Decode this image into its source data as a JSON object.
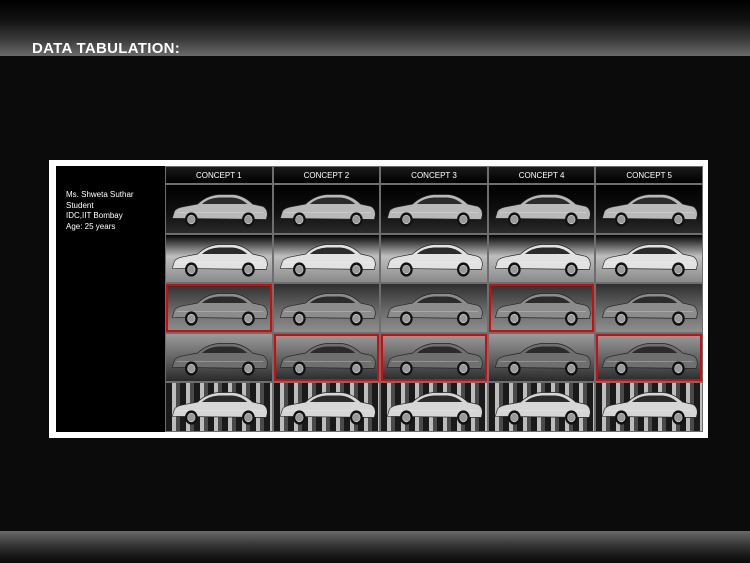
{
  "slide": {
    "title": "DATA TABULATION:"
  },
  "respondent": {
    "name": "Ms. Shweta Suthar",
    "role": "Student",
    "institute": "IDC,IIT Bombay",
    "age": "Age: 25 years"
  },
  "table": {
    "columns": [
      "CONCEPT 1",
      "CONCEPT 2",
      "CONCEPT 3",
      "CONCEPT 4",
      "CONCEPT 5"
    ],
    "rows": [
      {
        "selected": [
          false,
          false,
          false,
          false,
          false
        ],
        "car_color": "#b9b9b9"
      },
      {
        "selected": [
          false,
          false,
          false,
          false,
          false
        ],
        "car_color": "#e2e2e2"
      },
      {
        "selected": [
          true,
          false,
          false,
          true,
          false
        ],
        "car_color": "#8c8c8c"
      },
      {
        "selected": [
          false,
          true,
          true,
          false,
          true
        ],
        "car_color": "#6f6f6f"
      },
      {
        "selected": [
          false,
          false,
          false,
          false,
          false
        ],
        "car_color": "#d6d6d6"
      }
    ]
  },
  "colors": {
    "selection_highlight": "#d10a0a",
    "background": "#0b0b0b",
    "panel": "#ffffff"
  }
}
